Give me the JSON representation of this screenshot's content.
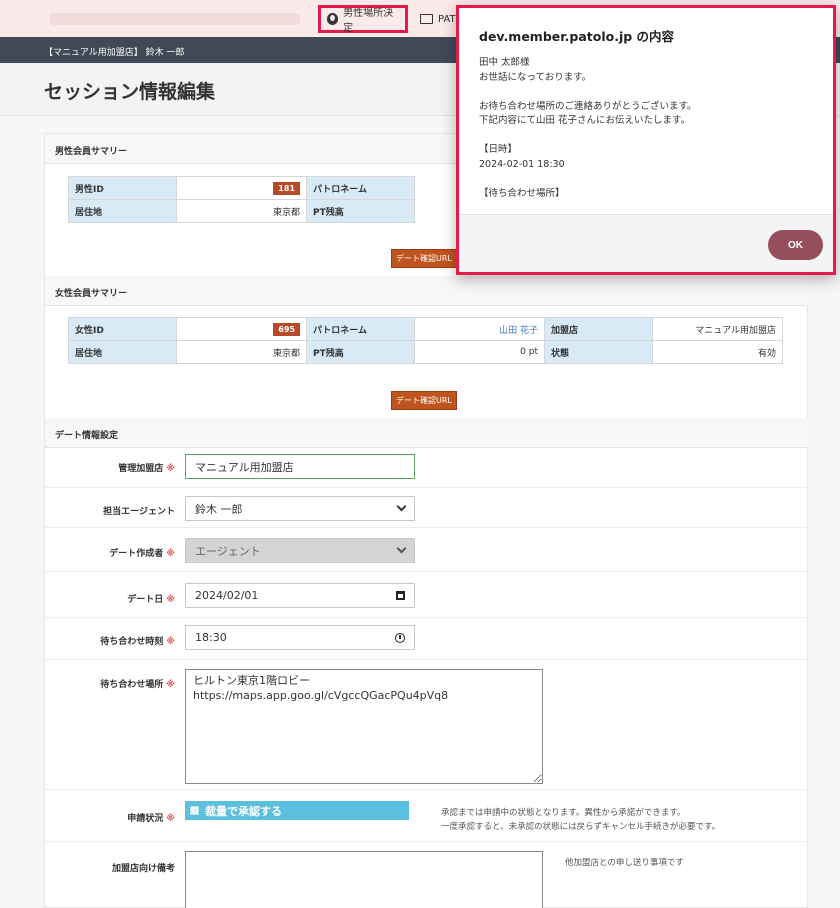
{
  "bookmarks": {
    "highlighted_label": "男性場所決定",
    "folder_label": "PAT"
  },
  "app": {
    "store_user": "【マニュアル用加盟店】 鈴木 一郎",
    "page_title": "セッション情報編集"
  },
  "male_summary": {
    "section_title": "男性会員サマリー",
    "id_label": "男性ID",
    "id_value": "181",
    "points_name_label": "パトロネーム",
    "residence_label": "居住地",
    "residence_value": "東京都",
    "pt_label": "PT残高",
    "date_url_button": "デート確認URL"
  },
  "female_summary": {
    "section_title": "女性会員サマリー",
    "id_label": "女性ID",
    "id_value": "695",
    "points_name_label": "パトロネーム",
    "points_name_value": "山田 花子",
    "store_label": "加盟店",
    "store_value": "マニュアル用加盟店",
    "residence_label": "居住地",
    "residence_value": "東京都",
    "pt_label": "PT残高",
    "pt_value": "0 pt",
    "status_label": "状態",
    "status_value": "有効",
    "date_url_button": "デート確認URL"
  },
  "date_settings": {
    "section_title": "デート情報設定",
    "required_mark": "※",
    "store_label": "管理加盟店",
    "store_value": "マニュアル用加盟店",
    "agent_label": "担当エージェント",
    "agent_value": "鈴木 一郎",
    "creator_label": "デート作成者",
    "creator_value": "エージェント",
    "date_label": "デート日",
    "date_value": "2024/02/01",
    "time_label": "待ち合わせ時刻",
    "time_value": "18:30",
    "place_label": "待ち合わせ場所",
    "place_value": "ヒルトン東京1階ロビー\nhttps://maps.app.goo.gl/cVgccQGacPQu4pVq8",
    "status_label": "申請状況",
    "approve_label": "裁量で承認する",
    "approve_note_1": "承認までは申請中の状態となります。異性から承諾ができます。",
    "approve_note_2": "一度承認すると、未承認の状態には戻らずキャンセル手続きが必要です。",
    "memo_label": "加盟店向け備考",
    "memo_note": "他加盟店との申し送り事項です"
  },
  "dialog": {
    "title": "dev.member.patolo.jp の内容",
    "lines": [
      "田中 太郎様",
      "お世話になっております。",
      "",
      "お待ち合わせ場所のご連絡ありがとうございます。",
      "下記内容にて山田 花子さんにお伝えいたします。",
      "",
      "【日時】",
      "2024-02-01 18:30",
      "",
      "【待ち合わせ場所】"
    ],
    "ok_label": "OK"
  }
}
